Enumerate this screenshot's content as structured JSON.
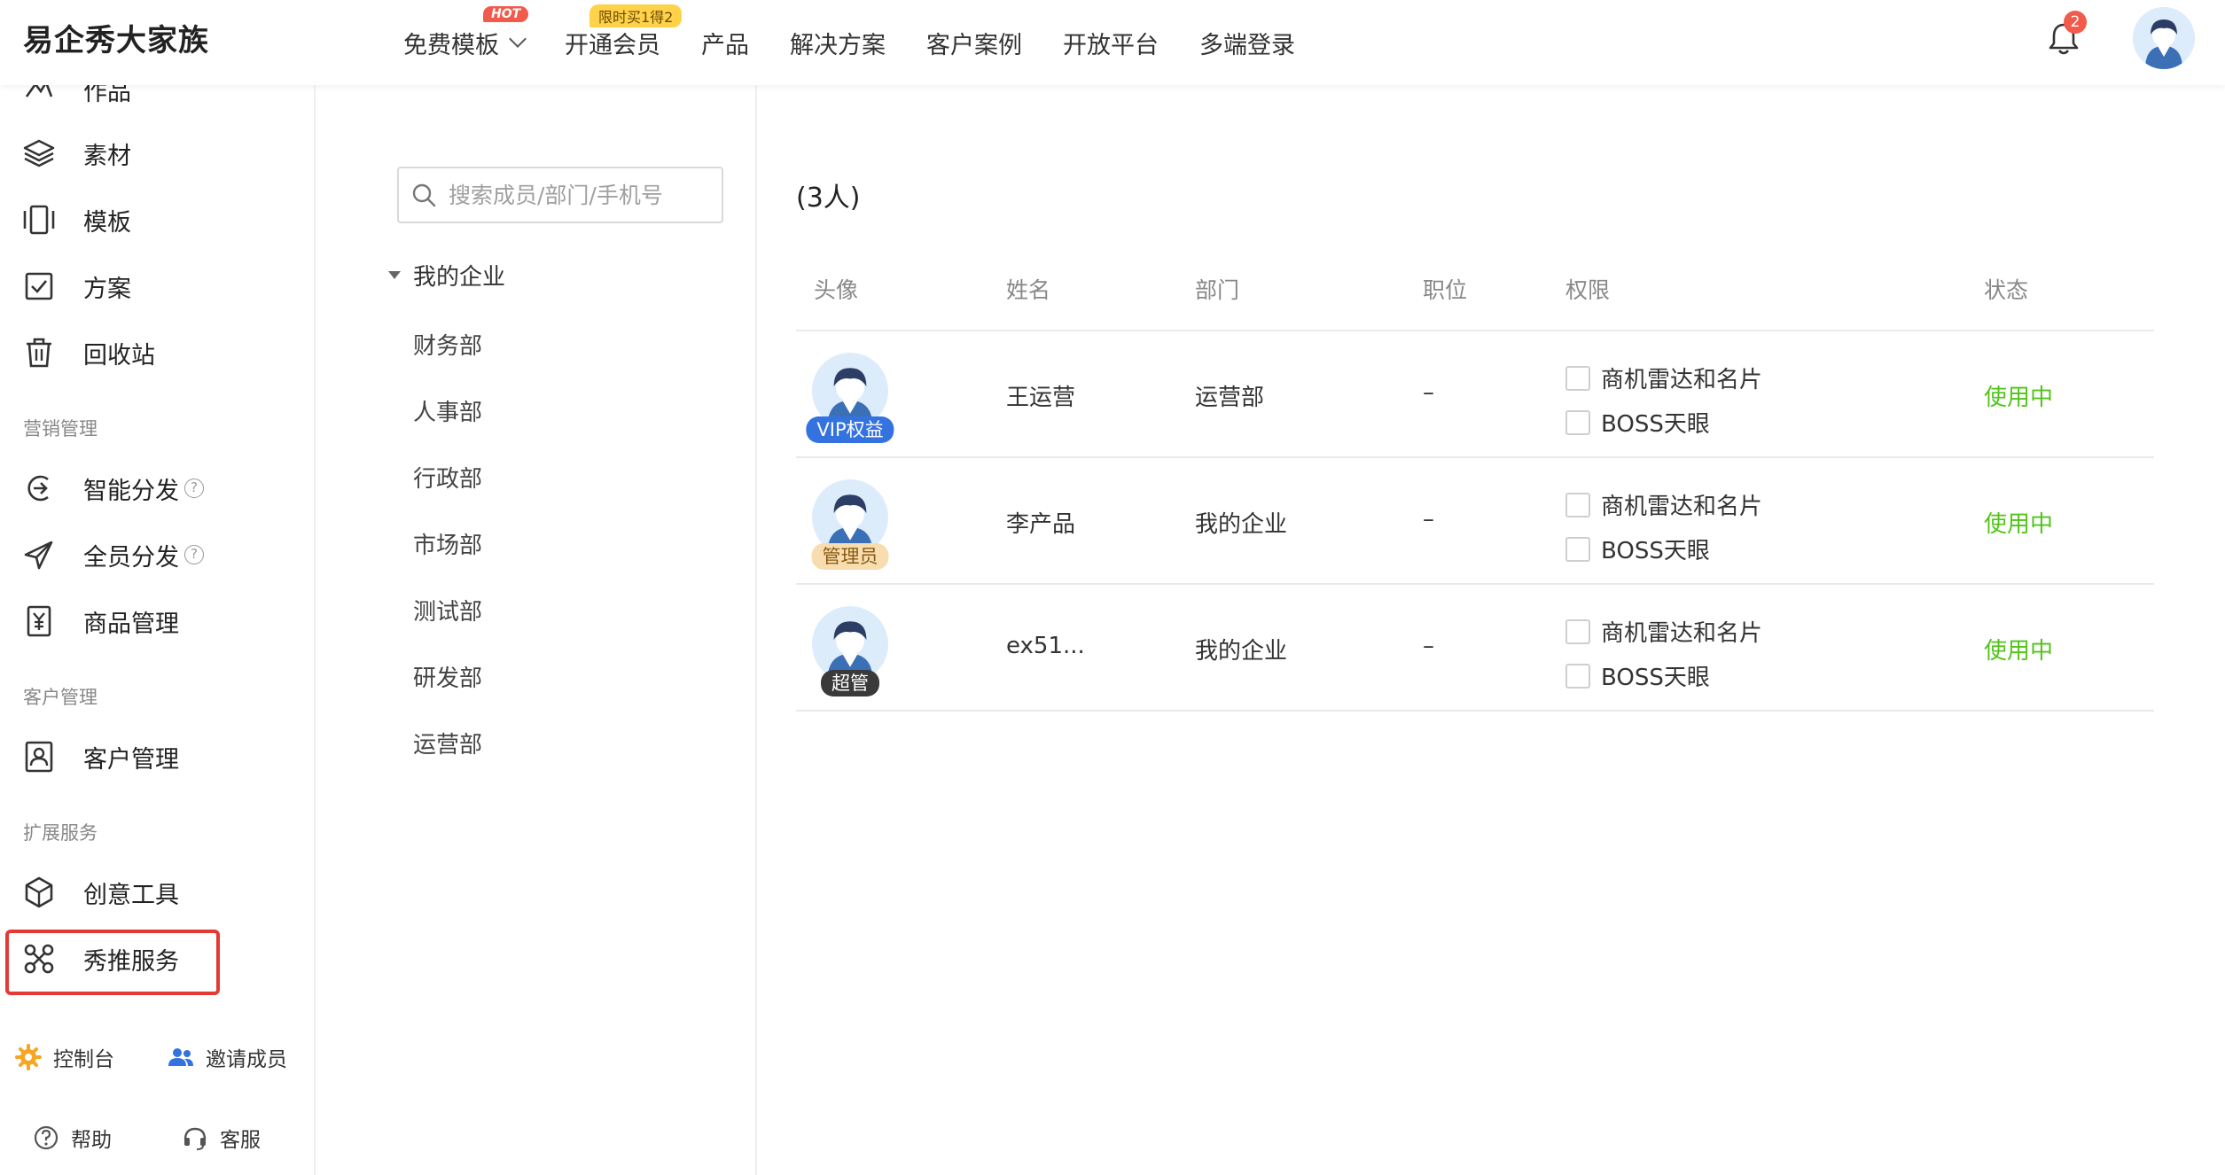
{
  "app": {
    "brand": "易企秀大家族"
  },
  "topnav": {
    "items": [
      {
        "label": "免费模板",
        "badge": "HOT",
        "has_dropdown": true
      },
      {
        "label": "开通会员",
        "badge": "限时买1得2"
      },
      {
        "label": "产品"
      },
      {
        "label": "解决方案"
      },
      {
        "label": "客户案例"
      },
      {
        "label": "开放平台"
      },
      {
        "label": "多端登录"
      }
    ],
    "notification_count": "2"
  },
  "sidebar": {
    "items": [
      {
        "label": "作品",
        "icon": "works-icon"
      },
      {
        "label": "素材",
        "icon": "layers-icon"
      },
      {
        "label": "模板",
        "icon": "template-icon"
      },
      {
        "label": "方案",
        "icon": "checkbox-icon"
      },
      {
        "label": "回收站",
        "icon": "trash-icon"
      }
    ],
    "groups": {
      "marketing": {
        "title": "营销管理",
        "items": [
          {
            "label": "智能分发",
            "icon": "smart-distribute-icon",
            "help": "?"
          },
          {
            "label": "全员分发",
            "icon": "send-icon",
            "help": "?"
          },
          {
            "label": "商品管理",
            "icon": "product-icon"
          }
        ]
      },
      "customer": {
        "title": "客户管理",
        "items": [
          {
            "label": "客户管理",
            "icon": "contact-icon"
          }
        ]
      },
      "extension": {
        "title": "扩展服务",
        "items": [
          {
            "label": "创意工具",
            "icon": "cube-icon"
          },
          {
            "label": "秀推服务",
            "icon": "push-service-icon",
            "highlighted": true
          }
        ]
      }
    },
    "footer": {
      "console": "控制台",
      "invite": "邀请成员",
      "help": "帮助",
      "service": "客服"
    }
  },
  "departments": {
    "search_placeholder": "搜索成员/部门/手机号",
    "root": "我的企业",
    "items": [
      "财务部",
      "人事部",
      "行政部",
      "市场部",
      "测试部",
      "研发部",
      "运营部"
    ]
  },
  "members": {
    "title_suffix": "(3人)",
    "columns": [
      "头像",
      "姓名",
      "部门",
      "职位",
      "权限",
      "状态"
    ],
    "rows": [
      {
        "role_tag": "VIP权益",
        "name": "王运营",
        "dept": "运营部",
        "position": "–",
        "perms": [
          "商机雷达和名片",
          "BOSS天眼"
        ],
        "status": "使用中"
      },
      {
        "role_tag": "管理员",
        "name": "李产品",
        "dept": "我的企业",
        "position": "–",
        "perms": [
          "商机雷达和名片",
          "BOSS天眼"
        ],
        "status": "使用中"
      },
      {
        "role_tag": "超管",
        "name": "ex51...",
        "dept": "我的企业",
        "position": "–",
        "perms": [
          "商机雷达和名片",
          "BOSS天眼"
        ],
        "status": "使用中"
      }
    ]
  },
  "colors": {
    "accent": "#3472e0",
    "status_active": "#52c41a",
    "highlight_border": "#e53935",
    "badge_red": "#f25a4b"
  }
}
